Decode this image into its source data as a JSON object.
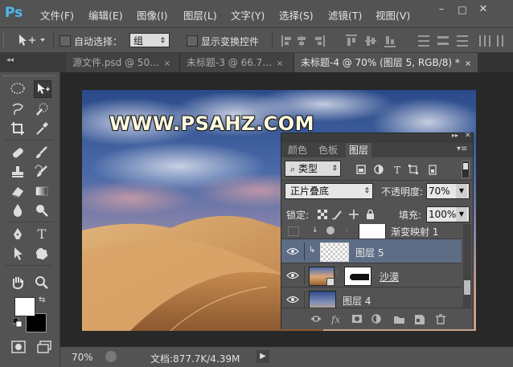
{
  "app": {
    "logo": "Ps"
  },
  "menubar": {
    "items": [
      "文件(F)",
      "编辑(E)",
      "图像(I)",
      "图层(L)",
      "文字(Y)",
      "选择(S)",
      "滤镜(T)",
      "视图(V)"
    ],
    "window_controls": [
      "–",
      "□",
      "✕"
    ]
  },
  "options": {
    "auto_select_label": "自动选择：",
    "auto_select_value": "组",
    "show_transform_label": "显示变换控件"
  },
  "tabs": [
    {
      "label": "源文件.psd @ 50...",
      "close": "×"
    },
    {
      "label": "未标题-3 @ 66.7...",
      "close": "×"
    },
    {
      "label": "未标题-4 @ 70% (图层 5, RGB/8) *",
      "close": "×"
    }
  ],
  "canvas": {
    "watermark": "WWW.PSAHZ.COM"
  },
  "status": {
    "zoom": "70%",
    "doc_info": "文档:877.7K/4.39M"
  },
  "layers_panel": {
    "tabs": [
      "颜色",
      "色板",
      "图层"
    ],
    "filter_label": "类型",
    "blend_mode": "正片叠底",
    "opacity_label": "不透明度:",
    "opacity_value": "70%",
    "lock_label": "锁定:",
    "fill_label": "填充:",
    "fill_value": "100%",
    "layers": [
      {
        "name": "渐变映射 1"
      },
      {
        "name": "图层 5"
      },
      {
        "name": "沙漠"
      },
      {
        "name": "图层 4"
      }
    ]
  },
  "colors": {
    "ps_blue": "#4fb8f0",
    "ui_panel": "#535353",
    "selected_layer": "#5d6d85"
  }
}
